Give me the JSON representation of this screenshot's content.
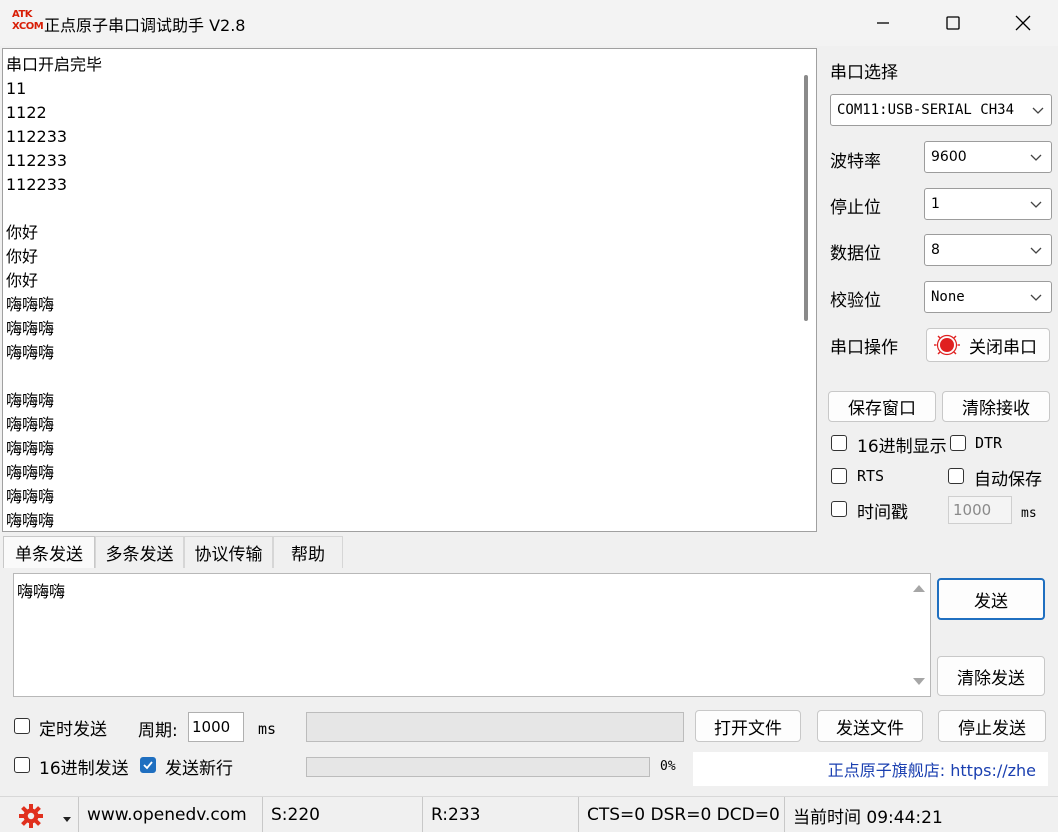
{
  "window": {
    "logo_top": "ATK",
    "logo_bottom": "XCOM",
    "title": "正点原子串口调试助手 V2.8",
    "controls": [
      "minimize",
      "maximize",
      "close"
    ]
  },
  "receive": {
    "lines": [
      "串口开启完毕",
      "11",
      "1122",
      "112233",
      "112233",
      "112233",
      "",
      "你好",
      "你好",
      "你好",
      "嗨嗨嗨",
      "嗨嗨嗨",
      "嗨嗨嗨",
      "",
      "嗨嗨嗨",
      "嗨嗨嗨",
      "嗨嗨嗨",
      "嗨嗨嗨",
      "嗨嗨嗨",
      "嗨嗨嗨"
    ]
  },
  "settings": {
    "port_label": "串口选择",
    "port_value": "COM11:USB-SERIAL CH34",
    "baud_label": "波特率",
    "baud_value": "9600",
    "stopbits_label": "停止位",
    "stopbits_value": "1",
    "databits_label": "数据位",
    "databits_value": "8",
    "parity_label": "校验位",
    "parity_value": "None",
    "op_label": "串口操作",
    "close_port_label": "关闭串口",
    "status_color": "#e02020"
  },
  "recv_controls": {
    "save_window": "保存窗口",
    "clear_recv": "清除接收",
    "hex_display": "16进制显示",
    "dtr": "DTR",
    "rts": "RTS",
    "auto_save": "自动保存",
    "timestamp": "时间戳",
    "timestamp_value": "1000",
    "ms": "ms"
  },
  "tabs": [
    "单条发送",
    "多条发送",
    "协议传输",
    "帮助"
  ],
  "send": {
    "text": "嗨嗨嗨",
    "send_button": "发送",
    "clear_send": "清除发送",
    "timed_send": "定时发送",
    "period_label": "周期:",
    "period_value": "1000",
    "ms": "ms",
    "open_file": "打开文件",
    "send_file": "发送文件",
    "stop_send": "停止发送",
    "hex_send": "16进制发送",
    "send_newline": "发送新行",
    "progress_text": "0%",
    "progress": 0,
    "store_link": "正点原子旗舰店: https://zhe",
    "link_color": "#1a3fb0"
  },
  "statusbar": {
    "website": "www.openedv.com",
    "sent": "S:220",
    "received": "R:233",
    "signals": "CTS=0 DSR=0 DCD=0",
    "time": "当前时间 09:44:21",
    "gear_color": "#e0301e"
  }
}
